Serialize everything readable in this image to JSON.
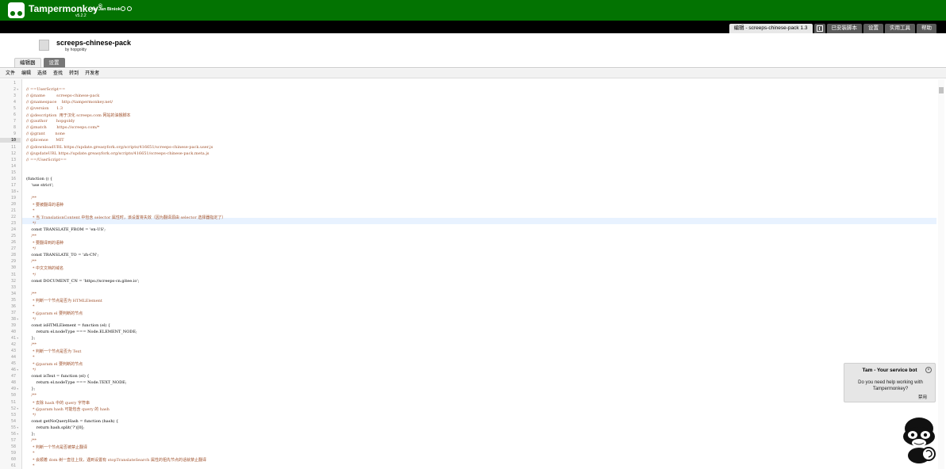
{
  "header": {
    "brand": "Tampermonkey",
    "reg": "®",
    "author": "by Jan Biniok",
    "version": "v5.2.2"
  },
  "nav": {
    "tabs": [
      {
        "label": "编辑 - screeps-chinese-pack 1.3",
        "active": true
      },
      {
        "label": "",
        "icon": "add-script-icon"
      },
      {
        "label": "已安装脚本"
      },
      {
        "label": "设置"
      },
      {
        "label": "实用工具"
      },
      {
        "label": "帮助"
      }
    ]
  },
  "script": {
    "name": "screeps-chinese-pack",
    "by": "by hopgoldy"
  },
  "subtabs": [
    {
      "label": "编辑器",
      "active": false
    },
    {
      "label": "设置",
      "active": true
    }
  ],
  "menu": [
    "文件",
    "编辑",
    "选择",
    "查找",
    "转到",
    "开发者"
  ],
  "editor": {
    "current_line": 10,
    "lines": [
      "",
      "// ==UserScript==",
      "// @name         screeps-chinese-pack",
      "// @namespace    http://tampermonkey.net/",
      "// @version      1.3",
      "// @description  用于汉化 screeps.com 网站的油猴脚本",
      "// @author       hopgoldy",
      "// @match        https://screeps.com/*",
      "// @grant        none",
      "// @license      MIT",
      "// @downloadURL https://update.greasyfork.org/scripts/416651/screeps-chinese-pack.user.js",
      "// @updateURL https://update.greasyfork.org/scripts/416651/screeps-chinese-pack.meta.js",
      "// ==/UserScript==",
      "",
      "",
      "(function () {",
      "    'use strict';",
      "",
      "    /**",
      "     * 要被翻译的语种",
      "     *",
      "     * 当 TranslationContent 中包含 selector 属性时，该设置将失效（因为翻译源由 selector 选择器指定了）",
      "     */",
      "    const TRANSLATE_FROM = 'en-US';",
      "    /**",
      "     * 要翻译到的语种",
      "     */",
      "    const TRANSLATE_TO = 'zh-CN';",
      "    /**",
      "     * 中文文档的域名",
      "     */",
      "    const DOCUMENT_CN = 'https://screeps-cn.gitee.io';",
      "",
      "    /**",
      "     * 判断一个节点是否为 HTMLElement",
      "     *",
      "     * @param el 要判断的节点",
      "     */",
      "    const isHTMLElement = function (el) {",
      "        return el.nodeType === Node.ELEMENT_NODE;",
      "    };",
      "    /**",
      "     * 判断一个节点是否为 Text",
      "     *",
      "     * @param el 要判断的节点",
      "     */",
      "    const isText = function (el) {",
      "        return el.nodeType === Node.TEXT_NODE;",
      "    };",
      "    /**",
      "     * 去除 hash 中的 query 字符串",
      "     * @param hash 可能包含 query 的 hash",
      "     */",
      "    const getNoQueryHash = function (hash) {",
      "        return hash.split('?')[0];",
      "    };",
      "    /**",
      "     * 判断一个节点是否被禁止翻译",
      "     *",
      "     * 会顺着 dom 树一直往上找，遇到设置有 stopTranslateSearch 属性的祖先节点的话就禁止翻译",
      "     *",
      ""
    ],
    "fold_lines": [
      2,
      18,
      38,
      41,
      46,
      49,
      52,
      55,
      56
    ]
  },
  "bot": {
    "title": "Tam - Your service bot",
    "message": "Do you need help working with Tampermonkey?",
    "disable": "禁用"
  }
}
